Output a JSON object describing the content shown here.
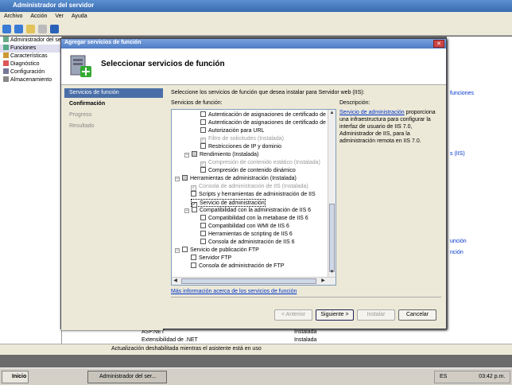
{
  "window": {
    "title": "Administrador del servidor"
  },
  "menu": [
    "Archivo",
    "Acción",
    "Ver",
    "Ayuda"
  ],
  "tree": [
    "Administrador del se",
    "Funciones",
    "Características",
    "Diagnóstico",
    "Configuración",
    "Almacenamiento"
  ],
  "bg_right": {
    "link1": "funciones",
    "link2": "s (IIS)",
    "link3": "unción",
    "link4": "nción"
  },
  "bg_list": [
    {
      "name": "ASP.NET",
      "state": "Instalada"
    },
    {
      "name": "Extensibilidad de .NET",
      "state": "Instalada"
    }
  ],
  "status": "Actualización deshabilitada mientras el asistente está en uso",
  "taskbar": {
    "start": "Inicio",
    "app": "Administrador del ser...",
    "lang": "ES",
    "time": "03:42 p.m."
  },
  "dialog": {
    "title": "Agregar servicios de función",
    "heading": "Seleccionar servicios de función",
    "nav": [
      "Servicios de función",
      "Confirmación",
      "Progreso",
      "Resultado"
    ],
    "intro": "Seleccione los servicios de función que desea instalar para Servidor web (IIS):",
    "services_label": "Servicios de función:",
    "description_label": "Descripción:",
    "description_link": "Servicio de administración",
    "description_text": " proporciona una infraestructura para configurar la interfaz de usuario de IIS 7.0, Administrador de IIS, para la administración remota en IIS 7.0.",
    "more_link": "Más información acerca de los servicios de función",
    "buttons": {
      "prev": "< Anterior",
      "next": "Siguiente >",
      "install": "Instalar",
      "cancel": "Cancelar"
    },
    "services": [
      {
        "label": "Autenticación de asignaciones de certificado de c"
      },
      {
        "label": "Autenticación de asignaciones de certificado de d"
      },
      {
        "label": "Autorización para URL"
      },
      {
        "label": "Filtro de solicitudes (Instalada)"
      },
      {
        "label": "Restricciones de IP y dominio"
      },
      {
        "label": "Rendimiento (Instalada)"
      },
      {
        "label": "Compresión de contenido estático (Instalada)"
      },
      {
        "label": "Compresión de contenido dinámico"
      },
      {
        "label": "Herramientas de administración (Instalada)"
      },
      {
        "label": "Consola de administración de IIS (Instalada)"
      },
      {
        "label": "Scripts y herramientas de administración de IIS"
      },
      {
        "label": "Servicio de administración"
      },
      {
        "label": "Compatibilidad con la administración de IIS 6"
      },
      {
        "label": "Compatibilidad con la metabase de IIS 6"
      },
      {
        "label": "Compatibilidad con WMI de IIS 6"
      },
      {
        "label": "Herramientas de scripting de IIS 6"
      },
      {
        "label": "Consola de administración de IIS 6"
      },
      {
        "label": "Servicio de publicación FTP"
      },
      {
        "label": "Servidor FTP"
      },
      {
        "label": "Consola de administración de FTP"
      }
    ]
  }
}
